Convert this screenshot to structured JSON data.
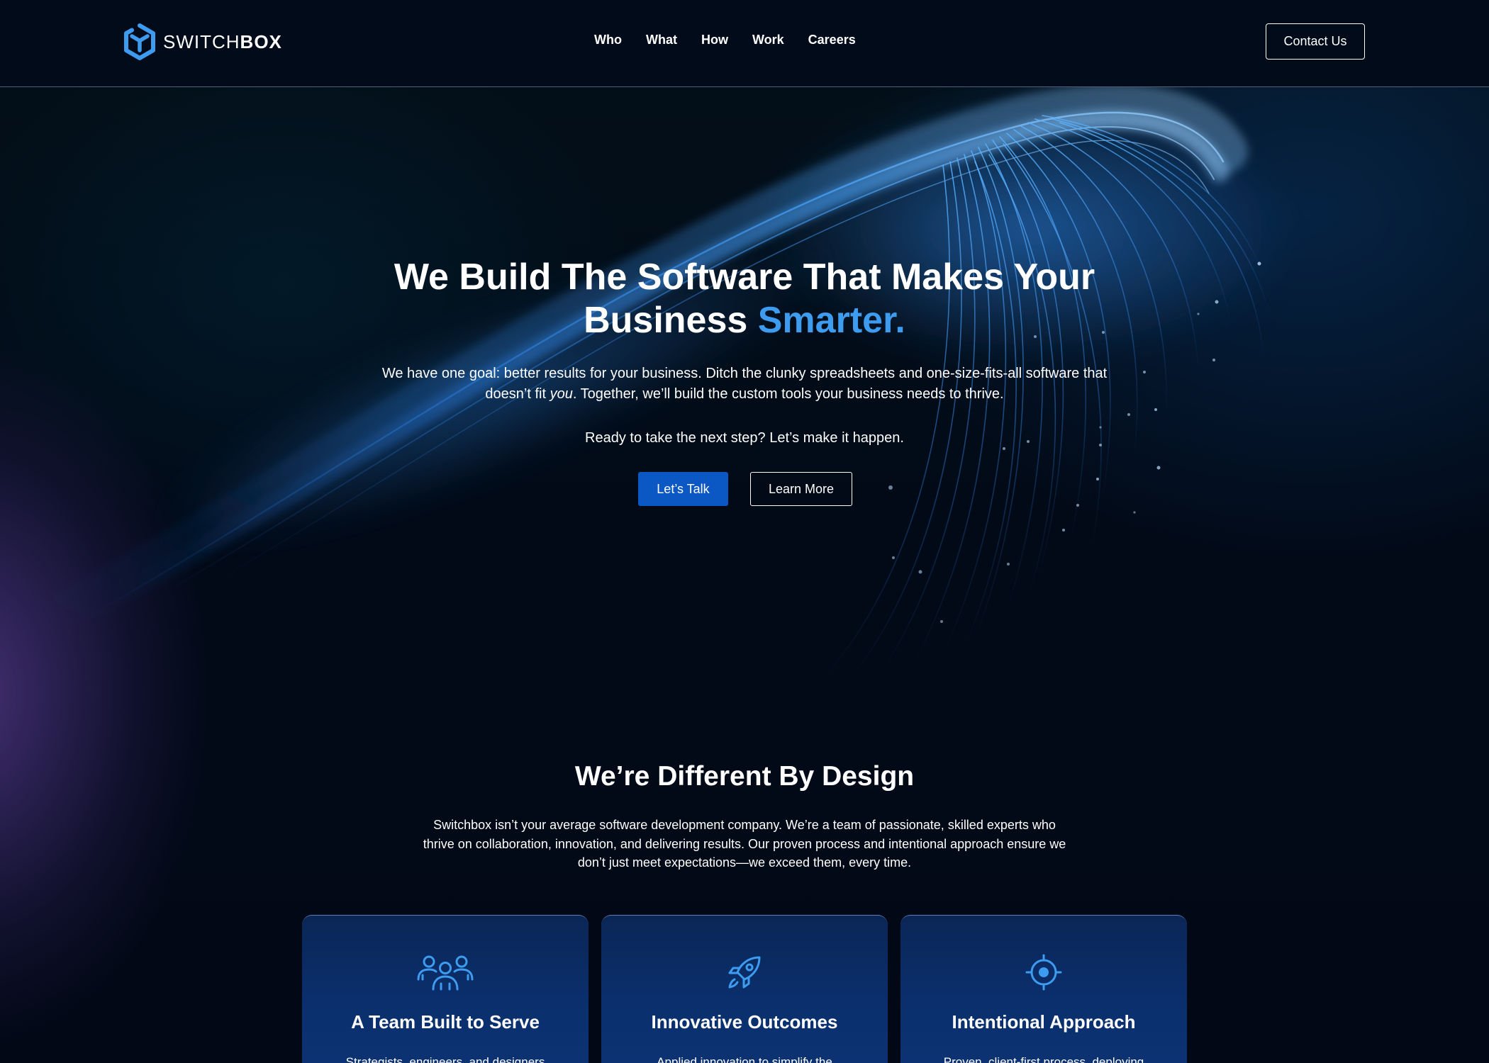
{
  "header": {
    "logo": {
      "thin": "SWITCH",
      "bold": "BOX"
    },
    "nav": [
      {
        "label": "Who"
      },
      {
        "label": "What"
      },
      {
        "label": "How"
      },
      {
        "label": "Work"
      },
      {
        "label": "Careers"
      }
    ],
    "contact_label": "Contact Us"
  },
  "hero": {
    "title_part1": "We Build The Software That Makes Your Business ",
    "title_accent": "Smarter.",
    "subtitle_before": "We have one goal: better results for your business. Ditch the clunky spreadsheets and one-size-fits-all software that doesn’t fit ",
    "subtitle_em": "you",
    "subtitle_after": ". Together, we’ll build the custom tools your business needs to thrive.",
    "cta_text": "Ready to take the next step? Let’s make it happen.",
    "primary_button": "Let’s Talk",
    "secondary_button": "Learn More"
  },
  "different": {
    "title": "We’re Different By Design",
    "body": "Switchbox isn’t your average software development company. We’re a team of passionate, skilled experts who thrive on collaboration, innovation, and delivering results. Our proven process and intentional approach ensure we don’t just meet expectations—we exceed them, every time."
  },
  "cards": [
    {
      "icon": "team-icon",
      "title": "A Team Built to Serve",
      "text": "Strategists, engineers, and designers"
    },
    {
      "icon": "rocket-icon",
      "title": "Innovative Outcomes",
      "text": "Applied innovation to simplify the"
    },
    {
      "icon": "target-icon",
      "title": "Intentional Approach",
      "text": "Proven, client-first process, deploying"
    }
  ],
  "colors": {
    "background": "#020814",
    "accent": "#3d9cf0",
    "primary_button": "#0b57c4",
    "card": "#0b2f6c"
  }
}
